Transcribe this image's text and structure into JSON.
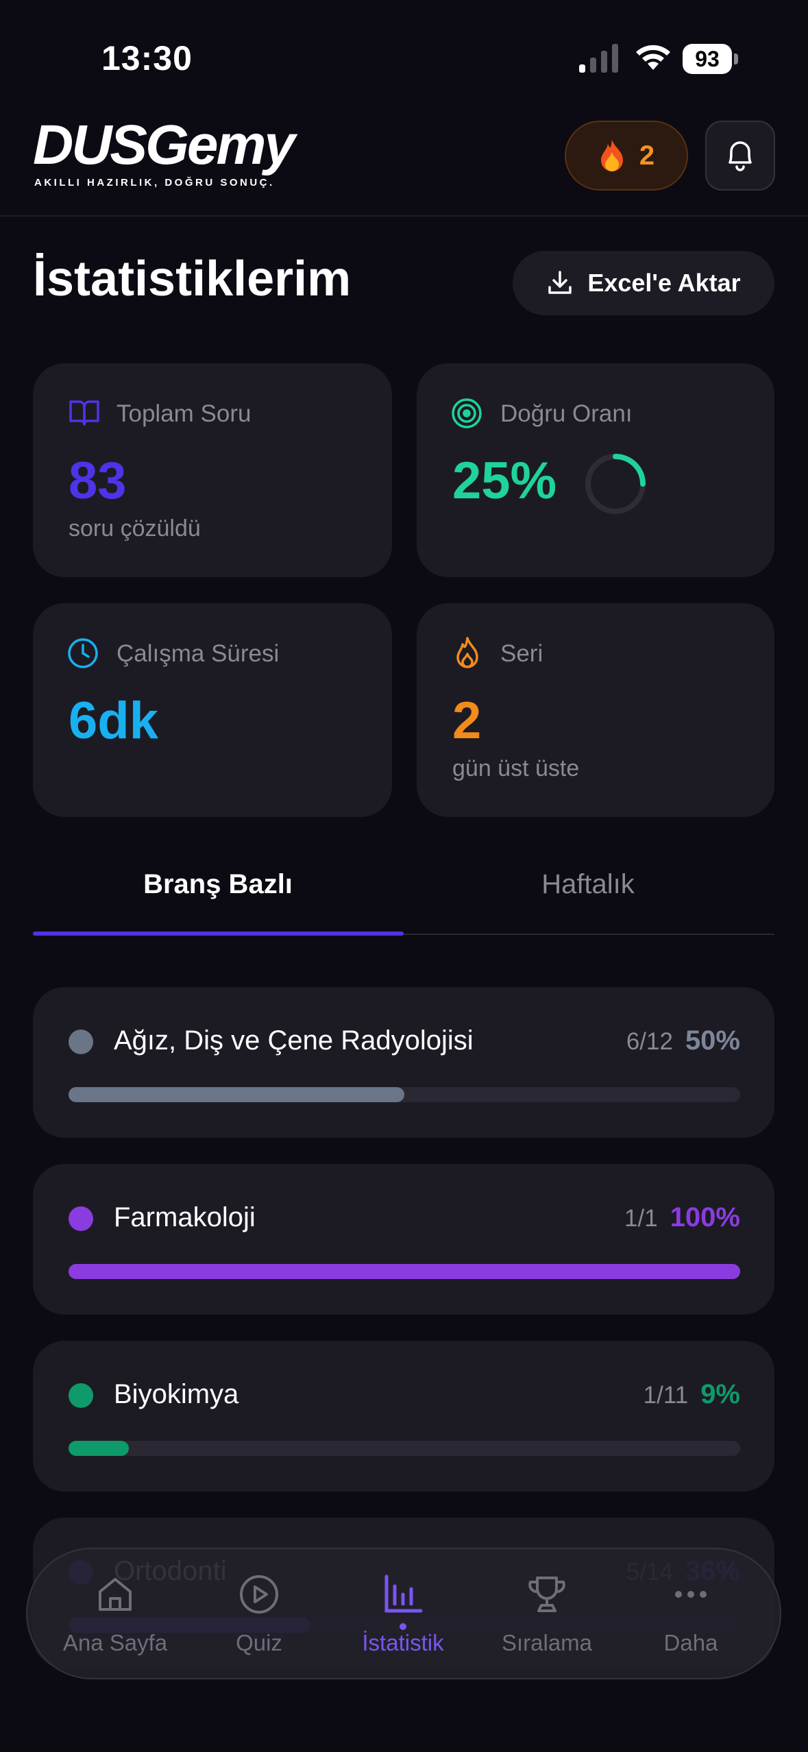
{
  "status": {
    "time": "13:30",
    "battery": "93"
  },
  "header": {
    "logo": "DUSGemy",
    "tagline": "AKILLI HAZIRLIK, DOĞRU SONUÇ.",
    "streak_count": "2"
  },
  "page": {
    "title": "İstatistiklerim",
    "export_label": "Excel'e Aktar"
  },
  "stats": {
    "total": {
      "label": "Toplam Soru",
      "value": "83",
      "sub": "soru çözüldü",
      "color": "#4d34e8"
    },
    "accuracy": {
      "label": "Doğru Oranı",
      "value": "25%",
      "fraction": 0.25,
      "color": "#1fd39a"
    },
    "time": {
      "label": "Çalışma Süresi",
      "value": "6dk",
      "color": "#19b0f0"
    },
    "streak": {
      "label": "Seri",
      "value": "2",
      "sub": "gün üst üste",
      "color": "#f38a1c"
    }
  },
  "tabs": [
    {
      "label": "Branş Bazlı",
      "active": true
    },
    {
      "label": "Haftalık",
      "active": false
    }
  ],
  "branches": [
    {
      "name": "Ağız, Diş ve Çene Radyolojisi",
      "count": "6/12",
      "percent": "50%",
      "fraction": 0.5,
      "color": "#6b7588"
    },
    {
      "name": "Farmakoloji",
      "count": "1/1",
      "percent": "100%",
      "fraction": 1.0,
      "color": "#8b3ce0"
    },
    {
      "name": "Biyokimya",
      "count": "1/11",
      "percent": "9%",
      "fraction": 0.09,
      "color": "#0e9a6a"
    },
    {
      "name": "Ortodonti",
      "count": "5/14",
      "percent": "36%",
      "fraction": 0.36,
      "color": "#6a4ce8"
    }
  ],
  "nav": [
    {
      "label": "Ana Sayfa",
      "icon": "home-icon"
    },
    {
      "label": "Quiz",
      "icon": "play-circle-icon"
    },
    {
      "label": "İstatistik",
      "icon": "bar-chart-icon",
      "active": true
    },
    {
      "label": "Sıralama",
      "icon": "trophy-icon"
    },
    {
      "label": "Daha",
      "icon": "more-icon"
    }
  ]
}
